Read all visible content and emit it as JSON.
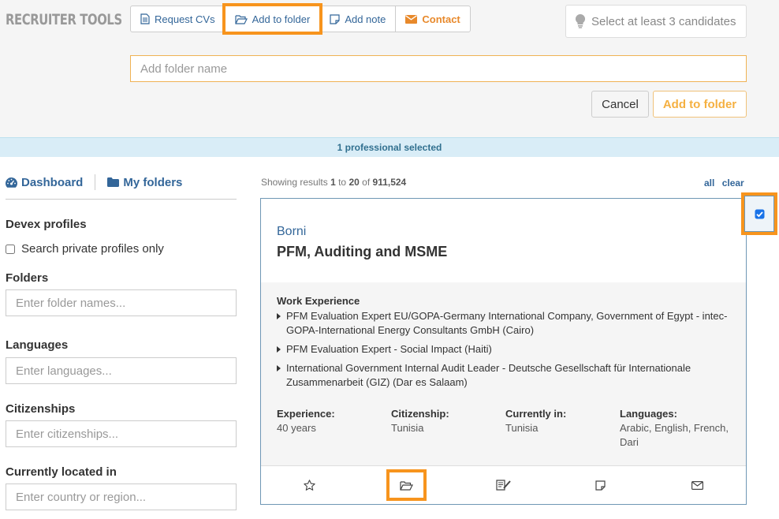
{
  "app": {
    "logo": "RECRUITER TOOLS"
  },
  "toolbar": {
    "request_cvs": "Request CVs",
    "add_to_folder": "Add to folder",
    "add_note": "Add note",
    "contact": "Contact"
  },
  "hint": "Select at least 3 candidates",
  "folder_form": {
    "placeholder": "Add folder name",
    "cancel": "Cancel",
    "submit": "Add to folder"
  },
  "selection_bar": "1 professional selected",
  "nav": {
    "dashboard": "Dashboard",
    "my_folders": "My folders"
  },
  "filters": {
    "devex_title": "Devex profiles",
    "private_only": "Search private profiles only",
    "folders_title": "Folders",
    "folders_placeholder": "Enter folder names...",
    "languages_title": "Languages",
    "languages_placeholder": "Enter languages...",
    "citizenships_title": "Citizenships",
    "citizenships_placeholder": "Enter citizenships...",
    "location_title": "Currently located in",
    "location_placeholder": "Enter country or region..."
  },
  "results": {
    "prefix": "Showing results",
    "from": "1",
    "to_word": "to",
    "to": "20",
    "of_word": "of",
    "total": "911,524",
    "all": "all",
    "clear": "clear"
  },
  "candidate": {
    "name": "Borni",
    "headline": "PFM, Auditing and MSME",
    "work_label": "Work Experience",
    "work": [
      "PFM Evaluation Expert EU/GOPA-Germany International Company, Government of Egypt - intec-GOPA-International Energy Consultants GmbH (Cairo)",
      "PFM Evaluation Expert - Social Impact (Haiti)",
      "International Government Internal Audit Leader - Deutsche Gesellschaft für Internationale Zusammenarbeit (GIZ) (Dar es Salaam)"
    ],
    "experience_label": "Experience:",
    "experience": "40 years",
    "citizenship_label": "Citizenship:",
    "citizenship": "Tunisia",
    "location_label": "Currently in:",
    "location": "Tunisia",
    "languages_label": "Languages:",
    "languages": "Arabic, English, French, Dari",
    "selected": true
  },
  "icons": {
    "accent": "#f7941d",
    "link": "#336699"
  }
}
